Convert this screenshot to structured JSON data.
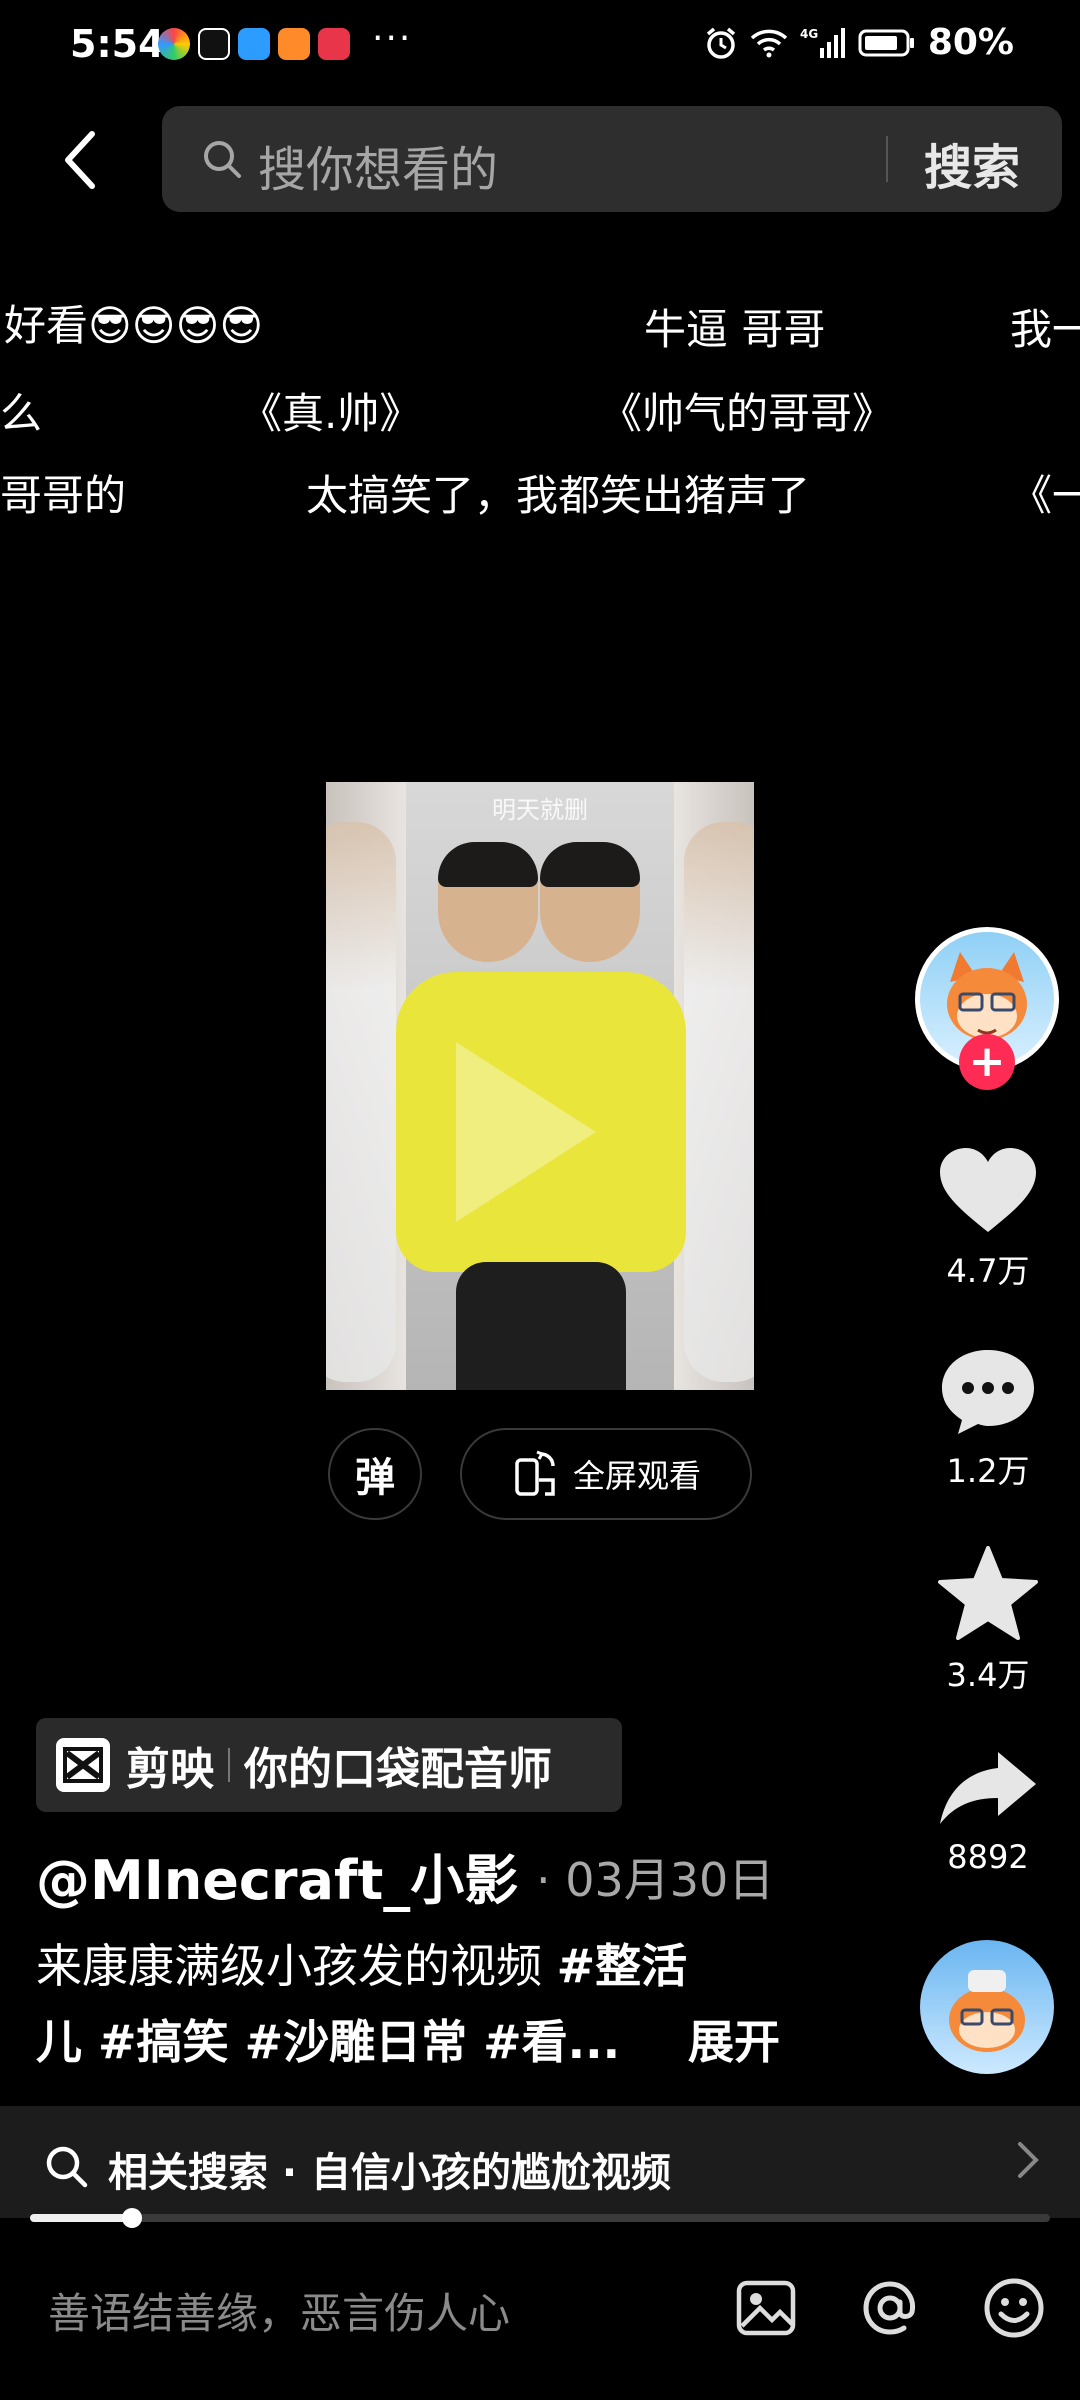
{
  "status_bar": {
    "time": "5:54",
    "more": "···",
    "battery": "80%",
    "network": "4G"
  },
  "search": {
    "placeholder": "搜你想看的",
    "button": "搜索"
  },
  "danmaku": [
    {
      "text": "好看😎😎😎😎"
    },
    {
      "text": "牛逼 哥哥"
    },
    {
      "text": "我一"
    },
    {
      "text": "么"
    },
    {
      "text": "《真.帅》"
    },
    {
      "text": "《帅气的哥哥》"
    },
    {
      "text": "哥哥的"
    },
    {
      "text": "太搞笑了，我都笑出猪声了"
    },
    {
      "text": "《一"
    }
  ],
  "video": {
    "watermark": "明天就删"
  },
  "controls": {
    "danmu_toggle": "弹",
    "fullscreen": "全屏观看"
  },
  "rail": {
    "likes": "4.7万",
    "comments": "1.2万",
    "favorites": "3.4万",
    "shares": "8892"
  },
  "capcut": {
    "name": "剪映",
    "slogan": "你的口袋配音师"
  },
  "post": {
    "author": "@MInecraft_小影",
    "date": "· 03月30日",
    "desc_line1_plain": "来康康满级小孩发的视频 ",
    "desc_line1_tag": "#整活",
    "desc_line2": "儿 #搞笑 #沙雕日常 #看...",
    "expand": "展开"
  },
  "related": {
    "text": "相关搜索 · 自信小孩的尴尬视频"
  },
  "progress": {
    "fraction": 0.1
  },
  "comment": {
    "placeholder": "善语结善缘，恶言伤人心"
  },
  "colors": {
    "accent_red": "#fe2c55",
    "background": "#000000",
    "search_bg": "#2e2e2e"
  }
}
